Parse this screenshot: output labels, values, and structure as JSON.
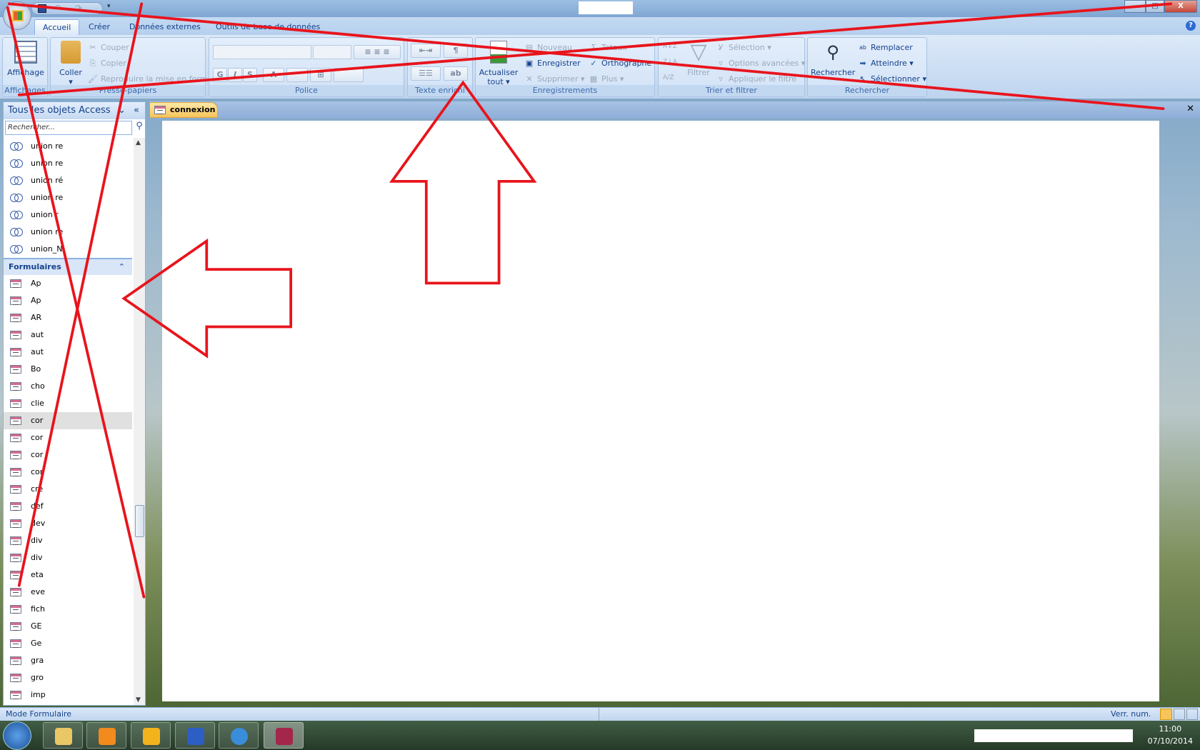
{
  "window": {
    "minimize": "–",
    "maximize": "□",
    "close": "X"
  },
  "ribbon_tabs": [
    "Accueil",
    "Créer",
    "Données externes",
    "Outils de base de données"
  ],
  "ribbon": {
    "affichage": {
      "button": "Affichage",
      "group": "Affichages"
    },
    "presse_papiers": {
      "coller": "Coller",
      "couper": "Couper",
      "copier": "Copier",
      "reproduire": "Reproduire la mise en forme",
      "group": "Presse-papiers"
    },
    "police": {
      "bold": "G",
      "italic": "I",
      "underline": "S",
      "font_color": "A",
      "group": "Police"
    },
    "texte_enrichi": {
      "group": "Texte enrichi"
    },
    "enregistrements": {
      "actualiser": "Actualiser tout",
      "nouveau": "Nouveau",
      "enregistrer": "Enregistrer",
      "supprimer": "Supprimer",
      "totaux": "Totaux",
      "orthographe": "Orthographe",
      "plus": "Plus",
      "group": "Enregistrements"
    },
    "trier": {
      "filtrer": "Filtrer",
      "selection": "Sélection",
      "options": "Options avancées",
      "appliquer": "Appliquer le filtre",
      "group": "Trier et filtrer"
    },
    "rechercher": {
      "rechercher": "Rechercher",
      "remplacer": "Remplacer",
      "atteindre": "Atteindre",
      "selectionner": "Sélectionner",
      "group": "Rechercher"
    }
  },
  "nav": {
    "title": "Tous les objets Access",
    "search_placeholder": "Rechercher...",
    "queries": [
      "union re",
      "union re",
      "union ré",
      "union re",
      "union r",
      "union re",
      "union_N"
    ],
    "forms_header": "Formulaires",
    "forms": [
      "Ap",
      "Ap",
      "AR",
      "aut",
      "aut",
      "Bo",
      "cho",
      "clie",
      "cor",
      "cor",
      "cor",
      "cor",
      "cre",
      "def",
      "dev",
      "div",
      "div",
      "eta",
      "eve",
      "fich",
      "GE",
      "Ge",
      "gra",
      "gro",
      "imp"
    ],
    "selected_form_index": 8
  },
  "document": {
    "tab": "connexion"
  },
  "status": {
    "mode": "Mode Formulaire",
    "numlock": "Verr. num."
  },
  "taskbar": {
    "time": "11:00",
    "date": "07/10/2014",
    "apps": [
      "explorer",
      "media-player",
      "outlook",
      "teamviewer",
      "internet-explorer",
      "access"
    ]
  },
  "annotation_color": "#e8141c"
}
